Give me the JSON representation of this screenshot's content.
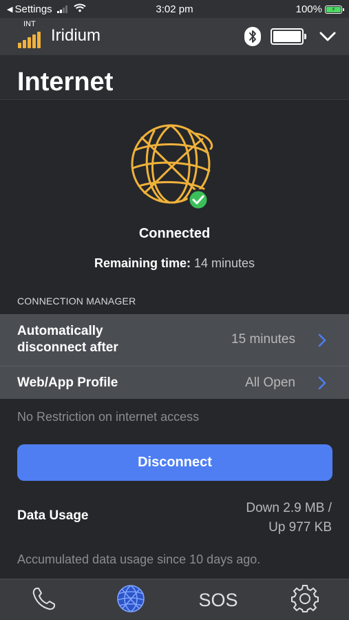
{
  "status_bar": {
    "back_label": "Settings",
    "time": "3:02 pm",
    "battery_percent": "100%"
  },
  "app_bar": {
    "network_label": "INT",
    "brand": "Iridium",
    "icons": [
      "bluetooth-icon",
      "device-battery-icon",
      "chevron-down-icon"
    ]
  },
  "page": {
    "title": "Internet"
  },
  "connection": {
    "status": "Connected",
    "remaining_label": "Remaining time:",
    "remaining_value": " 14 minutes"
  },
  "connection_manager": {
    "header": "CONNECTION MANAGER",
    "rows": [
      {
        "label": "Automatically disconnect after",
        "value": "15 minutes"
      },
      {
        "label": "Web/App Profile",
        "value": "All Open"
      }
    ],
    "note": "No Restriction on internet access"
  },
  "actions": {
    "disconnect_label": "Disconnect"
  },
  "data_usage": {
    "label": "Data Usage",
    "down": "Down 2.9 MB /",
    "up": "Up 977 KB",
    "note": "Accumulated data usage since 10 days ago."
  },
  "tab_bar": {
    "sos_label": "SOS",
    "tabs": [
      "phone-icon",
      "internet-globe-icon",
      "sos",
      "gear-icon"
    ]
  },
  "colors": {
    "accent_blue": "#4e7ef2",
    "iridium_gold": "#f0b23a",
    "success_green": "#3cbf5a",
    "background": "#25272b"
  }
}
